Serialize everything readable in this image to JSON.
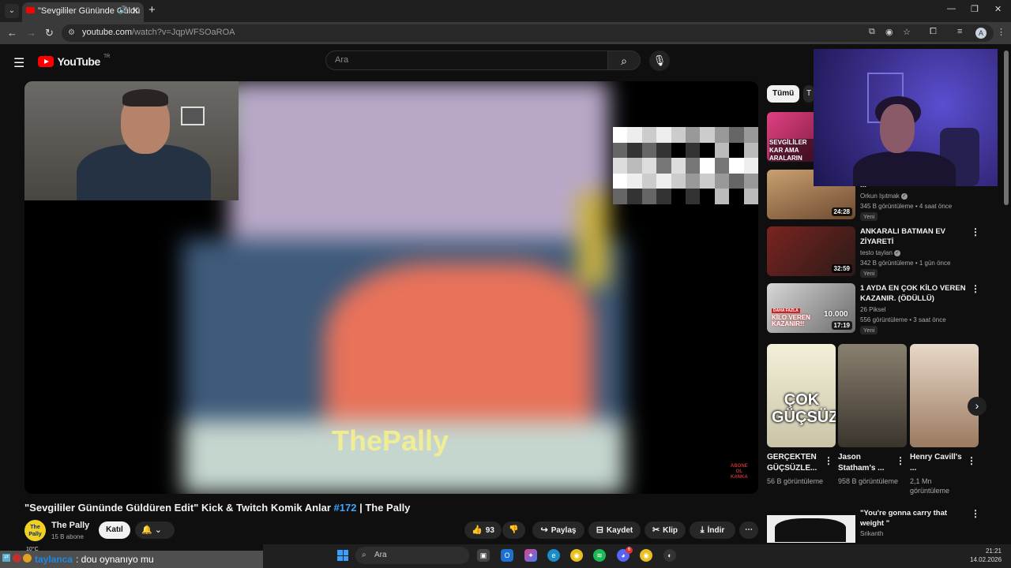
{
  "browser": {
    "tab_title": "\"Sevgililer Gününde Güldü",
    "url_host": "youtube.com",
    "url_path": "/watch?v=JqpWFSOaROA",
    "profile_initial": "A"
  },
  "youtube": {
    "logo_text": "YouTube",
    "country_code": "TR",
    "search_placeholder": "Ara"
  },
  "player": {
    "watermark": "ThePally",
    "corner_logo": "ABONE\nOL\nKANKA"
  },
  "video": {
    "title_main": "\"Sevgililer Gününde Güldüren Edit\" Kick & Twitch Komik Anlar ",
    "title_tag": "#172",
    "title_end": " | The Pally",
    "channel": "The Pally",
    "channel_avatar_text": "The\nPally",
    "subscribers": "15 B abone",
    "join_label": "Katıl",
    "likes": "93",
    "share_label": "Paylaş",
    "save_label": "Kaydet",
    "clip_label": "Klip",
    "download_label": "İndir"
  },
  "sidebar": {
    "chips": [
      "Tümü",
      "T"
    ],
    "first_thumb_text": "SEVGİLİLER KAR AMA ARALARIN",
    "recommendations": [
      {
        "title": "",
        "channel": "Orkun Işıtmak",
        "verified": true,
        "meta": "345 B görüntüleme • 4 saat önce",
        "badge": "Yeni",
        "duration": "24:28",
        "title_fragment": "..."
      },
      {
        "title": "ANKARALI BATMAN EV ZİYARETİ",
        "channel": "testo taylan",
        "verified": true,
        "meta": "342 B görüntüleme • 1 gün önce",
        "badge": "Yeni",
        "duration": "32:59"
      },
      {
        "title": "1 AYDA EN ÇOK KİLO VEREN KAZANIR. (ÖDÜLLÜ)",
        "channel": "26 Piksel",
        "verified": false,
        "meta": "556 görüntüleme • 3 saat önce",
        "badge": "Yeni",
        "duration": "17:19",
        "thumb_text": "KİLO VEREN KAZANIR!!",
        "thumb_text2": "DAHA FAZLA",
        "thumb_prize": "10.000"
      }
    ],
    "shorts": [
      {
        "title": "GERÇEKTEN GÜÇSÜZLE...",
        "views": "56 B görüntüleme",
        "thumb_text": "ÇOK GÜÇSÜZ"
      },
      {
        "title": "Jason Statham's ...",
        "views": "958 B görüntüleme",
        "thumb_text": ""
      },
      {
        "title": "Henry Cavill's ...",
        "views": "2,1 Mn görüntüleme",
        "thumb_text": ""
      }
    ],
    "last": {
      "title": "\"You're gonna carry that weight \"",
      "channel": "Srikanth"
    }
  },
  "chat": {
    "user": "taylanca",
    "message": ": dou oynanıyo mu"
  },
  "system": {
    "weather": "10°C",
    "taskbar_search": "Ara",
    "time": "21:21",
    "date": "14.02.2026",
    "discord_badge": "6"
  },
  "colors": {
    "bg": "#0f0f0f",
    "accent_link": "#3ea6ff",
    "yt_red": "#ff0000"
  }
}
